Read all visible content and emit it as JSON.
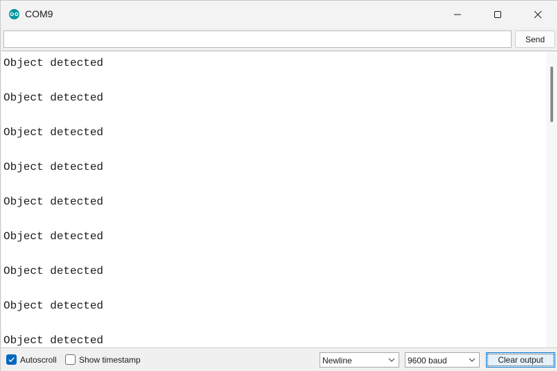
{
  "window": {
    "title": "COM9",
    "accent_color": "#0067c0",
    "app_icon": "arduino-icon",
    "controls": [
      "minimize-icon",
      "maximize-icon",
      "close-icon"
    ]
  },
  "input": {
    "value": "",
    "placeholder": "",
    "send_label": "Send"
  },
  "output": {
    "lines": [
      "Object detected",
      "Object detected",
      "Object detected",
      "Object detected",
      "Object detected",
      "Object detected",
      "Object detected",
      "Object detected",
      "Object detected"
    ]
  },
  "footer": {
    "autoscroll": {
      "label": "Autoscroll",
      "checked": true
    },
    "timestamp": {
      "label": "Show timestamp",
      "checked": false
    },
    "line_ending": {
      "selected": "Newline"
    },
    "baud_rate": {
      "selected": "9600 baud"
    },
    "clear_label": "Clear output"
  }
}
